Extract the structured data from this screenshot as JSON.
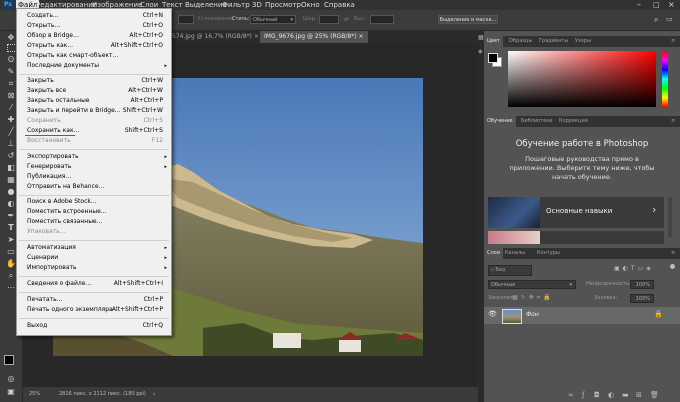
{
  "menubar": {
    "logo": "Ps",
    "items": [
      "Файл",
      "Редактирование",
      "Изображение",
      "Слои",
      "Текст",
      "Выделение",
      "Фильтр",
      "3D",
      "Просмотр",
      "Окно",
      "Справка"
    ]
  },
  "options": {
    "smoothing_label": "Сглаживание",
    "style_label": "Стиль:",
    "style_value": "Обычный",
    "width_label": "Шир.:",
    "height_label": "Выс.:",
    "select_mask_button": "Выделение и маска..."
  },
  "tabs": [
    {
      "label": "574.jpg @ 16,7% (RGB/8*)",
      "close": "×"
    },
    {
      "label": "IMG_9676.jpg @ 25% (RGB/8*)",
      "close": "×"
    }
  ],
  "file_menu": {
    "group1": [
      {
        "label": "Создать...",
        "shortcut": "Ctrl+N"
      },
      {
        "label": "Открыть...",
        "shortcut": "Ctrl+O"
      },
      {
        "label": "Обзор в Bridge...",
        "shortcut": "Alt+Ctrl+O"
      },
      {
        "label": "Открыть как...",
        "shortcut": "Alt+Shift+Ctrl+O"
      },
      {
        "label": "Открыть как смарт-объект...",
        "shortcut": ""
      },
      {
        "label": "Последние документы",
        "shortcut": ""
      }
    ],
    "group2": [
      {
        "label": "Закрыть",
        "shortcut": "Ctrl+W"
      },
      {
        "label": "Закрыть все",
        "shortcut": "Alt+Ctrl+W"
      },
      {
        "label": "Закрыть остальные",
        "shortcut": "Alt+Ctrl+P"
      },
      {
        "label": "Закрыть и перейти в Bridge...",
        "shortcut": "Shift+Ctrl+W"
      },
      {
        "label": "Сохранить",
        "shortcut": "Ctrl+S"
      },
      {
        "label": "Сохранить как...",
        "shortcut": "Shift+Ctrl+S"
      },
      {
        "label": "Восстановить",
        "shortcut": "F12"
      }
    ],
    "group3": [
      {
        "label": "Экспортировать"
      },
      {
        "label": "Генерировать"
      },
      {
        "label": "Публикация..."
      },
      {
        "label": "Отправить на Behance..."
      }
    ],
    "group4": [
      {
        "label": "Поиск в Adobe Stock..."
      },
      {
        "label": "Поместить встроенные..."
      },
      {
        "label": "Поместить связанные..."
      },
      {
        "label": "Упаковать..."
      }
    ],
    "group5": [
      {
        "label": "Автоматизация"
      },
      {
        "label": "Сценарии"
      },
      {
        "label": "Импортировать"
      }
    ],
    "info": {
      "label": "Сведения о файле...",
      "shortcut": "Alt+Shift+Ctrl+I"
    },
    "print": [
      {
        "label": "Печатать...",
        "shortcut": "Ctrl+P"
      },
      {
        "label": "Печать одного экземпляра",
        "shortcut": "Alt+Shift+Ctrl+P"
      }
    ],
    "exit": {
      "label": "Выход",
      "shortcut": "Ctrl+Q"
    },
    "submenu_arrow": "▸"
  },
  "color_panel": {
    "tabs": [
      "Цвет",
      "Образцы",
      "Градиенты",
      "Узоры"
    ]
  },
  "learn_panel": {
    "tabs": [
      "Обучение",
      "Библиотеки",
      "Коррекция"
    ],
    "title": "Обучение работе в Photoshop",
    "description": "Пошаговые руководства прямо в приложении. Выберите тему ниже, чтобы начать обучение.",
    "cards": [
      {
        "label": "Основные навыки",
        "arrow": "›"
      }
    ]
  },
  "layers_panel": {
    "tabs": [
      "Слои",
      "Каналы",
      "Контуры"
    ],
    "search_placeholder": "Вид",
    "blend_mode": "Обычные",
    "opacity_label": "Непрозрачность:",
    "opacity_value": "100%",
    "lock_label": "Закрепить:",
    "fill_label": "Заливка:",
    "fill_value": "100%",
    "layers": [
      {
        "name": "Фон"
      }
    ]
  },
  "status": {
    "zoom": "25%",
    "doc_info": "2816 пикс. x 2112 пикс. (180 ppi)"
  },
  "colors": {
    "accent_underline": "#c0392b",
    "menu_bg": "#f0f0f0",
    "panel_bg": "#535353"
  }
}
